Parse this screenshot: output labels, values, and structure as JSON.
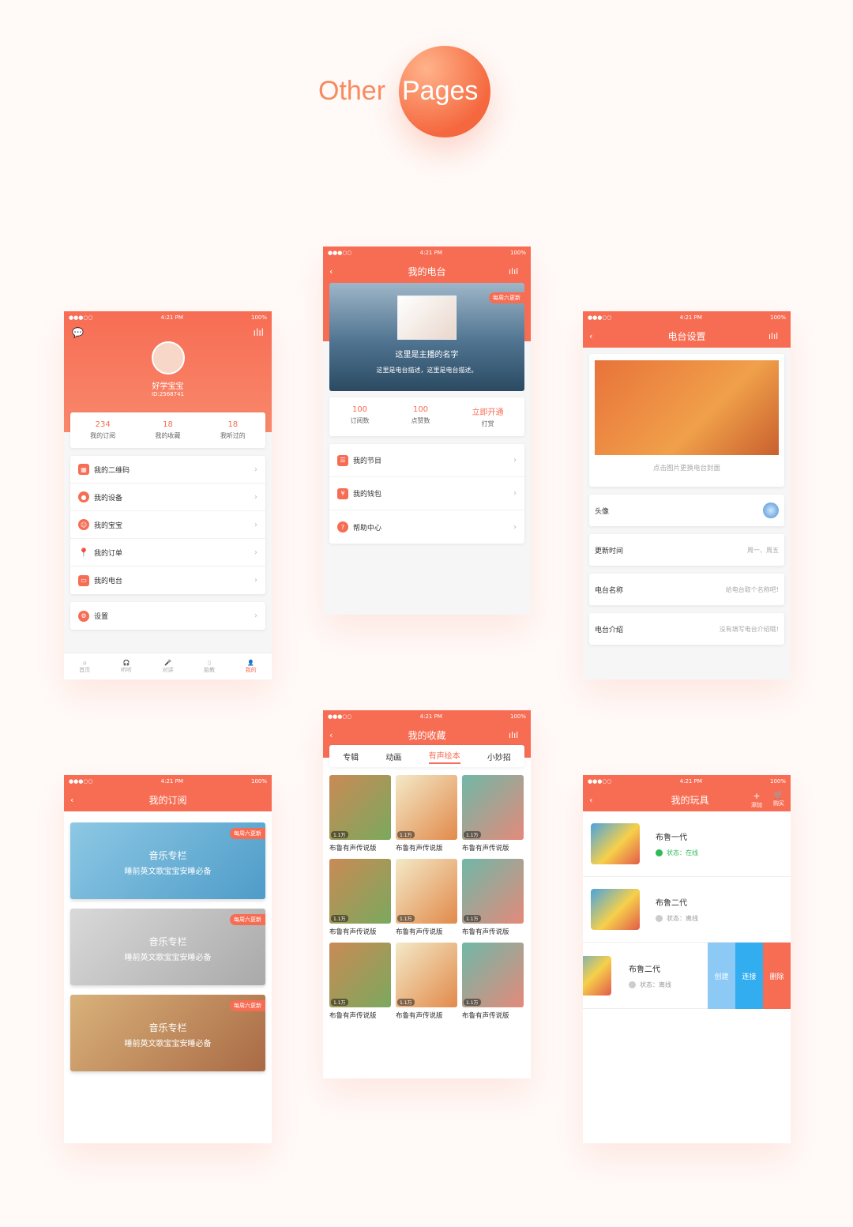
{
  "header": {
    "t1": "Other",
    "t2": "Pages"
  },
  "sb": {
    "time": "4:21 PM",
    "battery": "100%"
  },
  "p1": {
    "name": "好学宝宝",
    "id": "ID:2568741",
    "stats": [
      {
        "n": "234",
        "l": "我的订阅"
      },
      {
        "n": "18",
        "l": "我的收藏"
      },
      {
        "n": "18",
        "l": "我听过的"
      }
    ],
    "menu": [
      {
        "l": "我的二维码",
        "c": "#f76d54"
      },
      {
        "l": "我的设备",
        "c": "#f76d54"
      },
      {
        "l": "我的宝宝",
        "c": "#f76d54"
      },
      {
        "l": "我的订单",
        "c": "#f76d54"
      },
      {
        "l": "我的电台",
        "c": "#f76d54"
      }
    ],
    "setting": "设置",
    "tabs": [
      "首页",
      "听听",
      "对讲",
      "胎教",
      "我的"
    ]
  },
  "p2": {
    "title": "我的电台",
    "badge": "每周六更新",
    "host": "这里是主播的名字",
    "desc": "这里是电台描述，这里是电台描述。",
    "stats": [
      {
        "n": "100",
        "l": "订阅数"
      },
      {
        "n": "100",
        "l": "点赞数"
      },
      {
        "n": "立即开通",
        "l": "打赏"
      }
    ],
    "menu": [
      "我的节目",
      "我的钱包",
      "帮助中心"
    ]
  },
  "p3": {
    "title": "电台设置",
    "cover_hint": "点击图片更换电台封面",
    "rows": [
      {
        "l": "头像",
        "v": ""
      },
      {
        "l": "更新时间",
        "v": "周一、周五"
      },
      {
        "l": "电台名称",
        "v": "给电台取个名称吧!"
      },
      {
        "l": "电台介绍",
        "v": "没有填写电台介绍哦!"
      }
    ]
  },
  "p4": {
    "title": "我的订阅",
    "subs": [
      {
        "badge": "每周六更新",
        "a": "音乐专栏",
        "b": "睡前英文歌宝宝安睡必备"
      },
      {
        "badge": "每周六更新",
        "a": "音乐专栏",
        "b": "睡前英文歌宝宝安睡必备"
      },
      {
        "badge": "每周六更新",
        "a": "音乐专栏",
        "b": "睡前英文歌宝宝安睡必备"
      }
    ]
  },
  "p5": {
    "title": "我的收藏",
    "tabs": [
      "专辑",
      "动画",
      "有声绘本",
      "小妙招"
    ],
    "book": "布鲁有声传说版",
    "plays": "1.1万"
  },
  "p6": {
    "title": "我的玩具",
    "add": "添加",
    "buy": "购买",
    "toys": [
      {
        "n": "布鲁一代",
        "s": "状态：在线"
      },
      {
        "n": "布鲁二代",
        "s": "状态：离线"
      },
      {
        "n": "布鲁二代",
        "s": "状态：离线"
      }
    ],
    "actions": [
      "创建",
      "连接",
      "删除"
    ]
  },
  "colors": {
    "accent": "#f76d54"
  }
}
